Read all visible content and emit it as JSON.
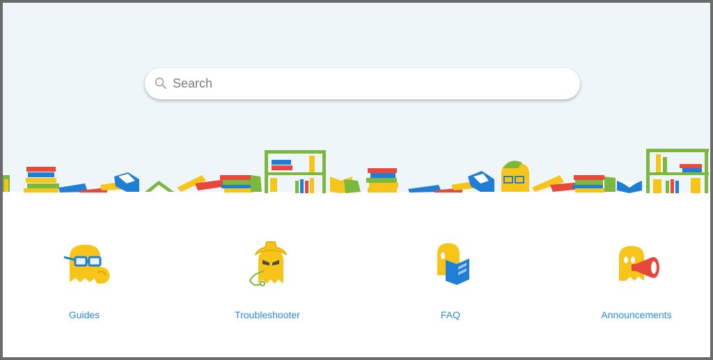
{
  "search": {
    "placeholder": "Search",
    "value": ""
  },
  "categories": [
    {
      "label": "Guides",
      "icon": "ghost-with-glasses-icon"
    },
    {
      "label": "Troubleshooter",
      "icon": "ghost-detective-icon"
    },
    {
      "label": "FAQ",
      "icon": "ghost-reading-book-icon"
    },
    {
      "label": "Announcements",
      "icon": "ghost-megaphone-icon"
    }
  ],
  "colors": {
    "hero_background": "#eef6fa",
    "link": "#2a8ad8",
    "ghost_yellow": "#f7c419",
    "book_blue": "#1f7fd6",
    "book_red": "#e8483a",
    "book_green": "#7cb83e"
  }
}
